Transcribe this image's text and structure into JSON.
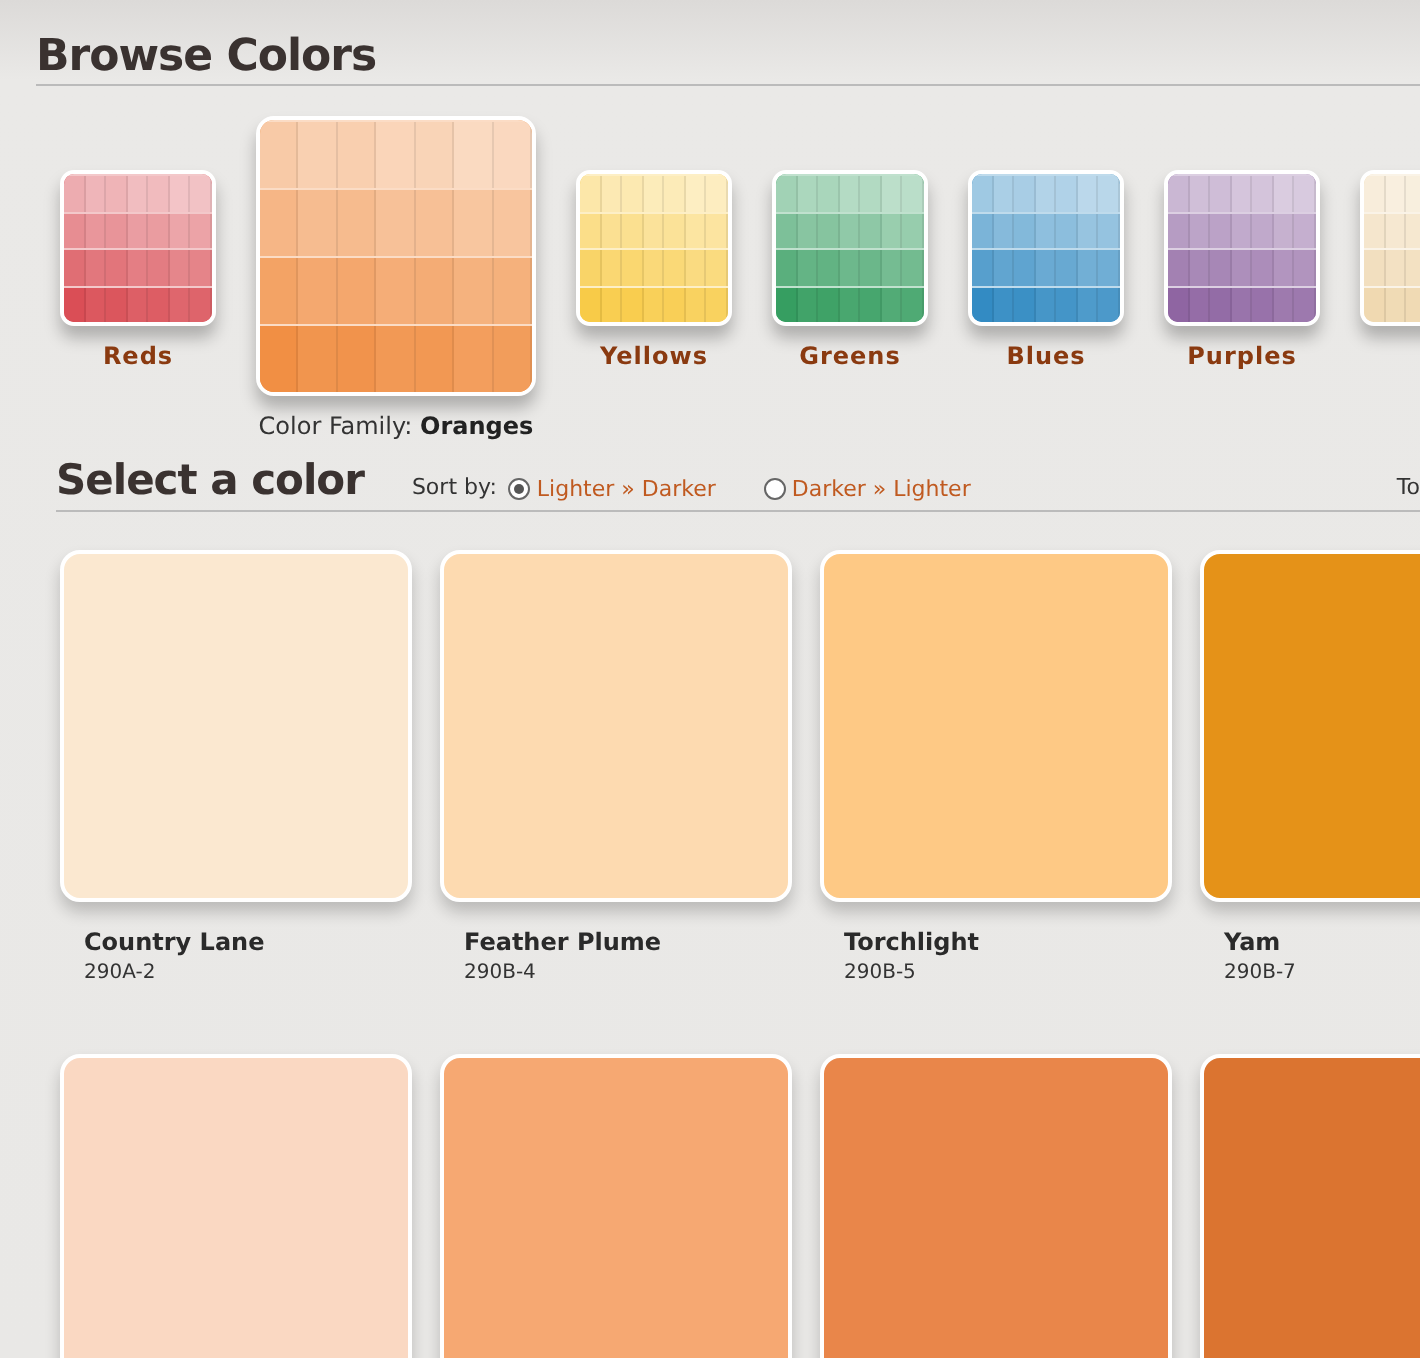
{
  "browse": {
    "title": "Browse Colors",
    "caption_prefix": "Color Family:",
    "families": [
      {
        "label": "Reds",
        "color": "#d8474f",
        "selected": false
      },
      {
        "label": "Oranges",
        "color": "#f08a3c",
        "selected": true
      },
      {
        "label": "Yellows",
        "color": "#f8c940",
        "selected": false
      },
      {
        "label": "Greens",
        "color": "#2e9a5a",
        "selected": false
      },
      {
        "label": "Blues",
        "color": "#2a86c0",
        "selected": false
      },
      {
        "label": "Purples",
        "color": "#8a5f9e",
        "selected": false
      },
      {
        "color": "#efd7ae",
        "selected": false
      }
    ]
  },
  "select": {
    "title": "Select a color",
    "sort_label": "Sort by:",
    "sort_options": [
      {
        "label": "Lighter » Darker",
        "selected": true
      },
      {
        "label": "Darker » Lighter",
        "selected": false
      }
    ],
    "right_text": "To",
    "swatches": [
      {
        "name": "Country Lane",
        "code": "290A-2",
        "color": "#fbe8d0"
      },
      {
        "name": "Feather Plume",
        "code": "290B-4",
        "color": "#fddab0"
      },
      {
        "name": "Torchlight",
        "code": "290B-5",
        "color": "#fec985"
      },
      {
        "name": "Yam",
        "code": "290B-7",
        "color": "#e59218"
      },
      {
        "color": "#fad8c2"
      },
      {
        "color": "#f6a872"
      },
      {
        "color": "#e9864a"
      },
      {
        "color": "#db7430"
      }
    ]
  }
}
